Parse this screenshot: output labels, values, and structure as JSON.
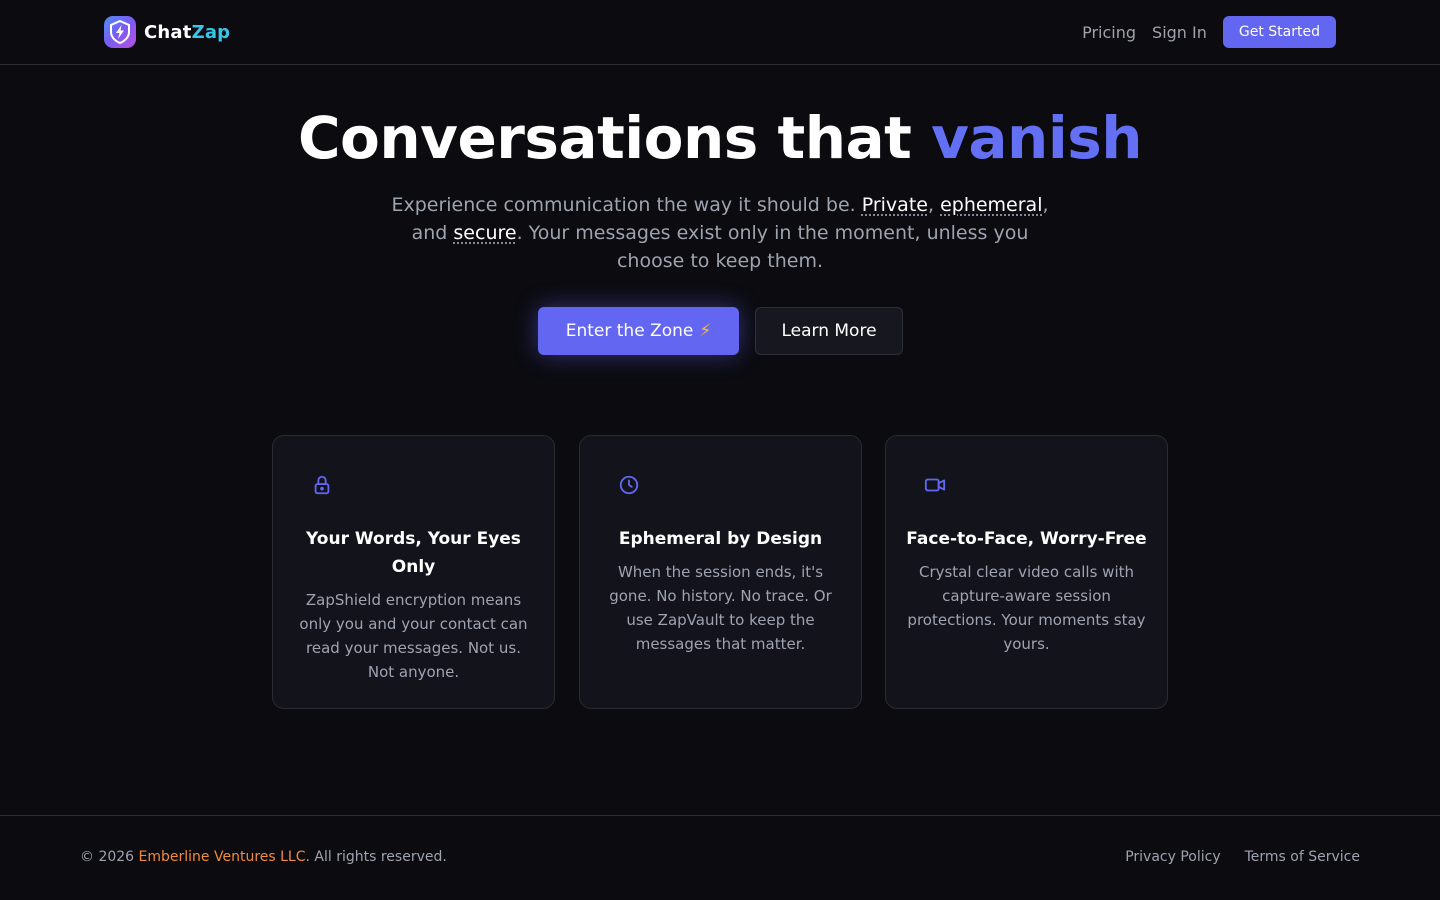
{
  "brand": {
    "name_part1": "Chat",
    "name_part2": "Zap",
    "logo_icon": "lightning-shield-icon"
  },
  "nav": {
    "pricing": "Pricing",
    "sign_in": "Sign In",
    "get_started": "Get Started"
  },
  "hero": {
    "title_main": "Conversations that",
    "title_accent": "vanish",
    "subtitle": {
      "part1": "Experience communication the way it should be. ",
      "word1": "Private",
      "sep1": ", ",
      "word2": "ephemeral",
      "sep2": ", and ",
      "word3": "secure",
      "part2": ". Your messages exist only in the moment, unless you choose to keep them."
    },
    "primary_button": "Enter the Zone",
    "primary_button_emoji": "⚡",
    "secondary_button": "Learn More"
  },
  "features": [
    {
      "icon": "lock-icon",
      "title": "Your Words, Your Eyes Only",
      "description": "ZapShield encryption means only you and your contact can read your messages. Not us. Not anyone."
    },
    {
      "icon": "clock-icon",
      "title": "Ephemeral by Design",
      "description": "When the session ends, it's gone. No history. No trace. Or use ZapVault to keep the messages that matter."
    },
    {
      "icon": "video-icon",
      "title": "Face-to-Face, Worry-Free",
      "description": "Crystal clear video calls with capture-aware session protections. Your moments stay yours."
    }
  ],
  "footer": {
    "copyright_prefix": "© 2026 ",
    "company": "Emberline Ventures LLC",
    "copyright_suffix": ". All rights reserved.",
    "privacy": "Privacy Policy",
    "terms": "Terms of Service"
  },
  "colors": {
    "background": "#0b0b10",
    "accent": "#6366f1",
    "brand_cyan": "#38c6e8",
    "company_orange": "#f08a3c",
    "muted_text": "#9ea3b0"
  }
}
